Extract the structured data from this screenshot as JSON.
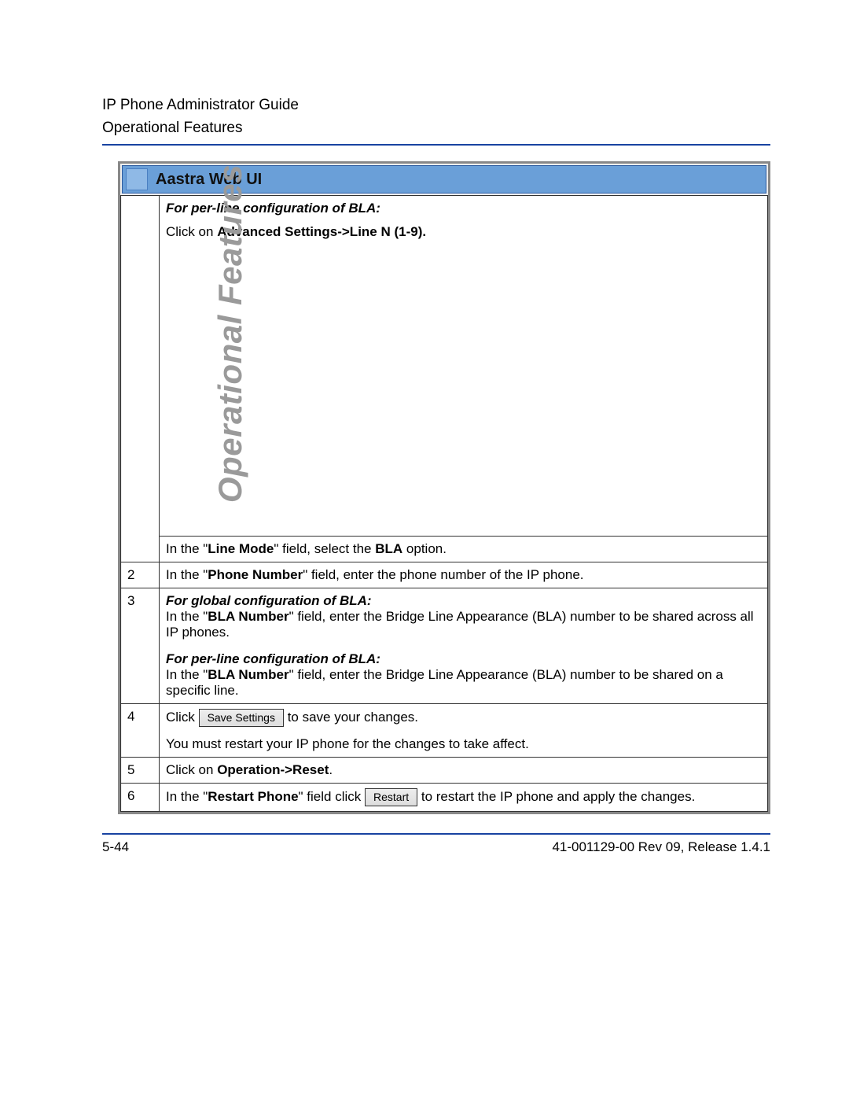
{
  "header": {
    "line1": "IP Phone Administrator Guide",
    "line2": "Operational Features"
  },
  "side_title": "Operational Features",
  "panel": {
    "title": "Aastra Web UI"
  },
  "steps": {
    "s1": {
      "heading": "For per-line configuration of BLA:",
      "intro_pre": "Click on ",
      "intro_bold": "Advanced Settings->Line N (1-9).",
      "line_mode_pre": "In the \"",
      "line_mode_bold1": "Line Mode",
      "line_mode_mid": "\" field, select the ",
      "line_mode_bold2": "BLA",
      "line_mode_post": " option."
    },
    "s2": {
      "num": "2",
      "pre": "In the \"",
      "bold": "Phone Number",
      "post": "\" field, enter the phone number of the IP phone."
    },
    "s3": {
      "num": "3",
      "global_heading": "For global configuration of BLA:",
      "global_pre": "In the \"",
      "global_bold": "BLA Number",
      "global_post": "\" field, enter the Bridge Line Appearance (BLA) number to be shared across all IP phones.",
      "perline_heading": "For per-line configuration of BLA:",
      "perline_pre": "In the \"",
      "perline_bold": "BLA Number",
      "perline_post": "\" field, enter the Bridge Line Appearance (BLA) number to be shared on a specific line."
    },
    "s4": {
      "num": "4",
      "click": "Click ",
      "btn": "Save Settings",
      "after": " to save your changes.",
      "note": "You must restart your IP phone for the changes to take affect."
    },
    "s5": {
      "num": "5",
      "pre": "Click on ",
      "bold": "Operation->Reset",
      "post": "."
    },
    "s6": {
      "num": "6",
      "pre": "In the \"",
      "bold": "Restart Phone",
      "mid": "\" field click ",
      "btn": "Restart",
      "post": " to restart the IP phone and apply the changes."
    }
  },
  "footer": {
    "left": "5-44",
    "right": "41-001129-00 Rev 09, Release 1.4.1"
  }
}
